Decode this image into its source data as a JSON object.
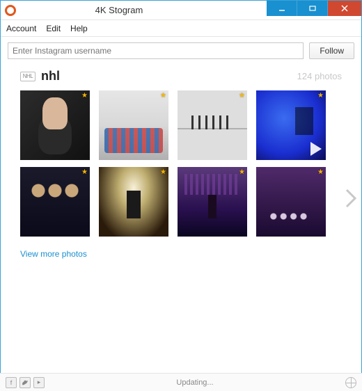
{
  "window": {
    "title": "4K Stogram"
  },
  "menu": {
    "account": "Account",
    "edit": "Edit",
    "help": "Help"
  },
  "search": {
    "placeholder": "Enter Instagram username",
    "follow_label": "Follow"
  },
  "account": {
    "tag_label": "NHL",
    "name": "nhl",
    "photo_count": "124 photos"
  },
  "thumbs": [
    {
      "is_video": false
    },
    {
      "is_video": false
    },
    {
      "is_video": false
    },
    {
      "is_video": true
    },
    {
      "is_video": false
    },
    {
      "is_video": false
    },
    {
      "is_video": false
    },
    {
      "is_video": false
    }
  ],
  "actions": {
    "view_more": "View more photos"
  },
  "status": {
    "text": "Updating..."
  }
}
